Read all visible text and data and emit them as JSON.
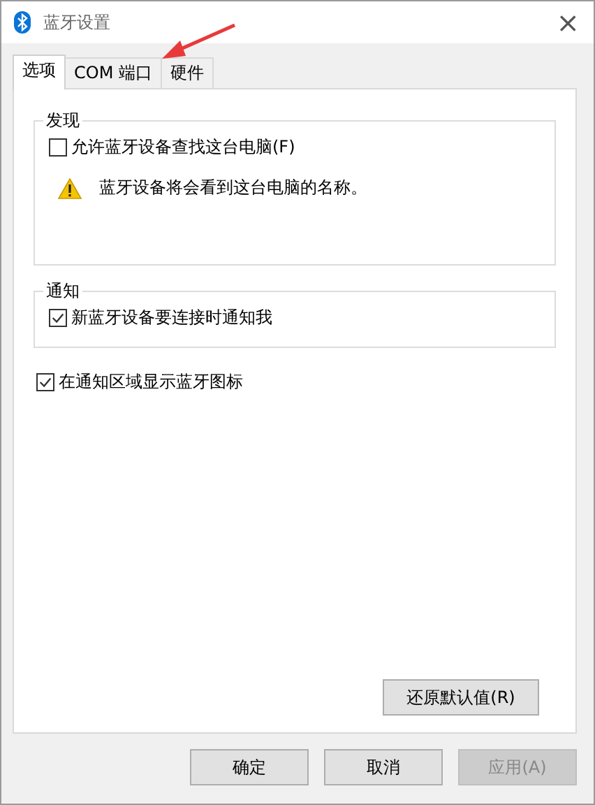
{
  "window": {
    "title": "蓝牙设置",
    "close": "×"
  },
  "tabs": [
    {
      "label": "选项",
      "selected": true
    },
    {
      "label": "COM 端口",
      "selected": false
    },
    {
      "label": "硬件",
      "selected": false
    }
  ],
  "groups": [
    {
      "title": "发现",
      "items": [
        {
          "kind": "checkbox",
          "label": "允许蓝牙设备查找这台电脑(F)",
          "checked": false
        },
        {
          "kind": "warning",
          "label": "蓝牙设备将会看到这台电脑的名称。"
        }
      ]
    },
    {
      "title": "通知",
      "items": [
        {
          "kind": "checkbox",
          "label": "新蓝牙设备要连接时通知我",
          "checked": true
        }
      ]
    }
  ],
  "options": [
    {
      "label": "在通知区域显示蓝牙图标",
      "checked": true
    }
  ],
  "reset_button": "还原默认值(R)",
  "buttons": [
    {
      "label": "确定",
      "disabled": false
    },
    {
      "label": "取消",
      "disabled": false
    },
    {
      "label": "应用(A)",
      "disabled": true
    }
  ]
}
